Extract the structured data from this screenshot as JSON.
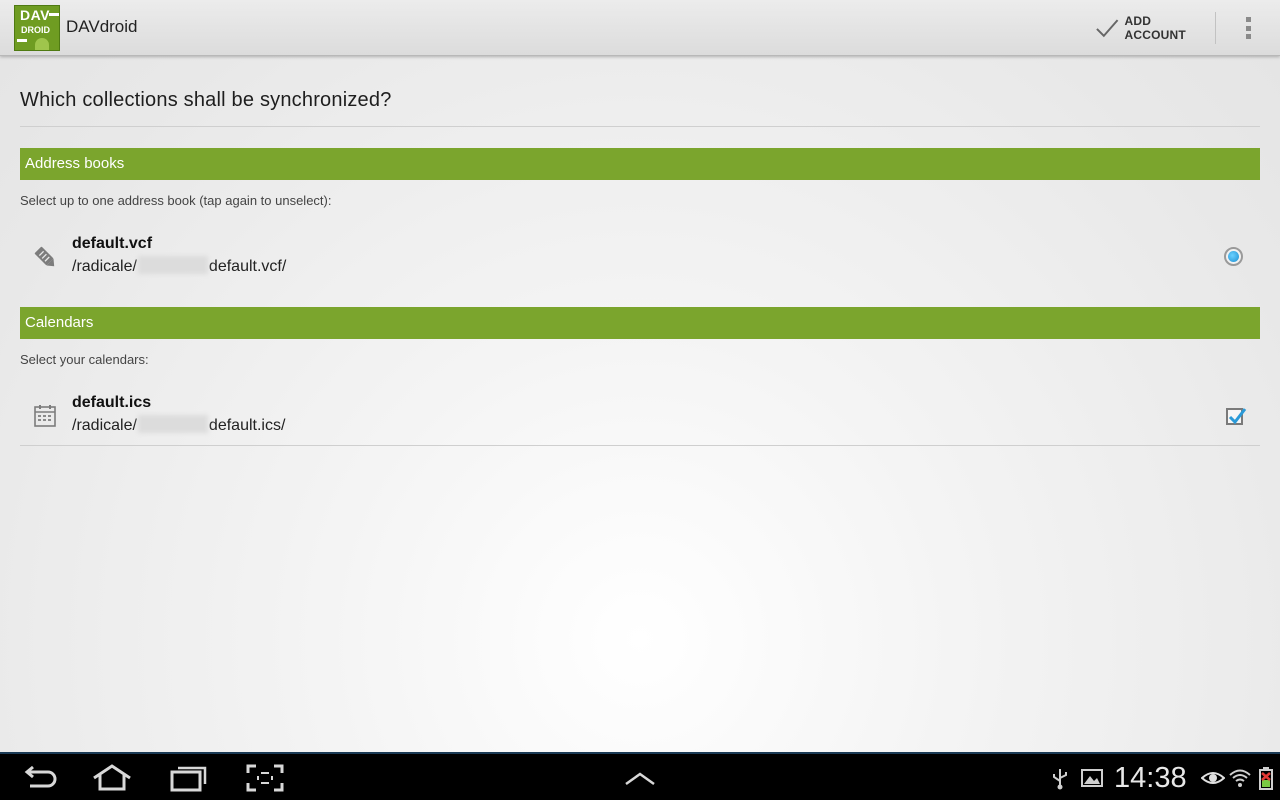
{
  "app": {
    "title": "DAVdroid",
    "icon_top": "DAV",
    "icon_bottom": "DROID",
    "accent": "#7ba52d"
  },
  "actionbar": {
    "add_account_label": "ADD ACCOUNT",
    "add_account_icon": "check-icon",
    "overflow_icon": "overflow-menu-icon"
  },
  "main": {
    "heading": "Which collections shall be synchronized?",
    "address_books": {
      "section_title": "Address books",
      "hint": "Select up to one address book (tap again to unselect):",
      "items": [
        {
          "name": "default.vcf",
          "path_prefix": "/radicale/",
          "path_suffix": "default.vcf/",
          "icon": "address-book-icon",
          "selected": true
        }
      ]
    },
    "calendars": {
      "section_title": "Calendars",
      "hint": "Select your calendars:",
      "items": [
        {
          "name": "default.ics",
          "path_prefix": "/radicale/",
          "path_suffix": "default.ics/",
          "icon": "calendar-icon",
          "checked": true
        }
      ]
    }
  },
  "systembar": {
    "clock": "14:38",
    "nav_icons": [
      "back-icon",
      "home-icon",
      "recent-apps-icon",
      "screenshot-icon",
      "up-arrow-icon"
    ],
    "status_icons": [
      "usb-icon",
      "gallery-icon",
      "eye-icon",
      "wifi-icon",
      "battery-icon"
    ]
  }
}
